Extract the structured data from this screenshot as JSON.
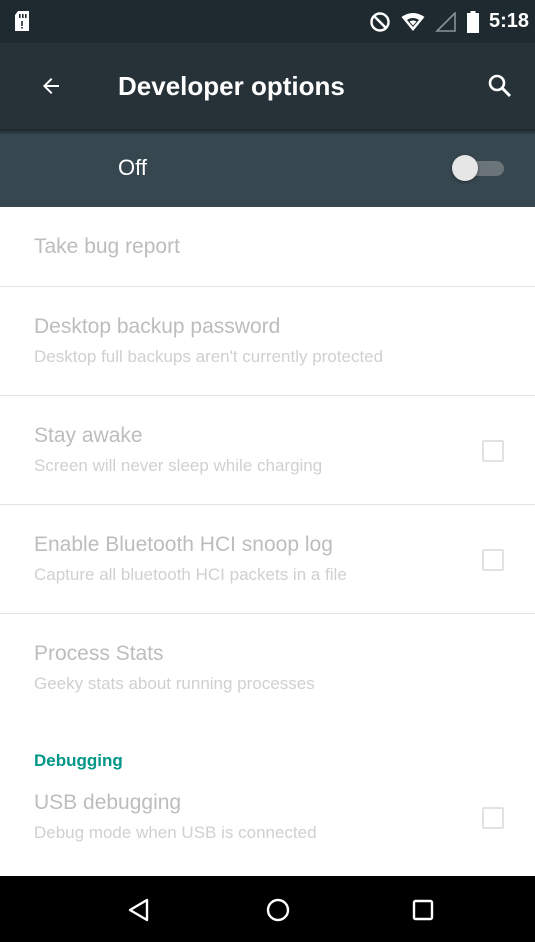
{
  "status_bar": {
    "time": "5:18",
    "icons": [
      "sd-card-icon",
      "do-not-disturb-icon",
      "wifi-icon",
      "cell-signal-icon",
      "battery-icon"
    ]
  },
  "toolbar": {
    "title": "Developer options",
    "back_icon": "arrow-back-icon",
    "search_icon": "search-icon"
  },
  "master_switch": {
    "label": "Off",
    "state": "off"
  },
  "settings": {
    "take_bug_report": {
      "title": "Take bug report"
    },
    "desktop_backup_password": {
      "title": "Desktop backup password",
      "summary": "Desktop full backups aren't currently protected"
    },
    "stay_awake": {
      "title": "Stay awake",
      "summary": "Screen will never sleep while charging",
      "checked": false
    },
    "bluetooth_hci_snoop_log": {
      "title": "Enable Bluetooth HCI snoop log",
      "summary": "Capture all bluetooth HCI packets in a file",
      "checked": false
    },
    "process_stats": {
      "title": "Process Stats",
      "summary": "Geeky stats about running processes"
    },
    "debugging_category": "Debugging",
    "usb_debugging": {
      "title": "USB debugging",
      "summary": "Debug mode when USB is connected",
      "checked": false
    }
  },
  "nav_bar": {
    "icons": [
      "back-triangle-icon",
      "home-circle-icon",
      "recents-square-icon"
    ]
  },
  "colors": {
    "status_bar": "#1f2a30",
    "toolbar": "#263238",
    "switch_bar": "#37474f",
    "accent": "#009688",
    "disabled_text": "#bdbdbd"
  }
}
